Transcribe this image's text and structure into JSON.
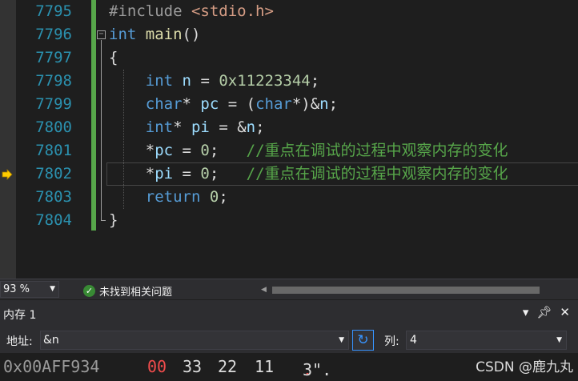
{
  "editor": {
    "lines": [
      {
        "num": "7795",
        "tokens": [
          {
            "t": "#include ",
            "c": "pp"
          },
          {
            "t": "<stdio.h>",
            "c": "inc"
          }
        ]
      },
      {
        "num": "7796",
        "tokens": [
          {
            "t": "int",
            "c": "kw"
          },
          {
            "t": " ",
            "c": "op"
          },
          {
            "t": "main",
            "c": "fn"
          },
          {
            "t": "()",
            "c": "op"
          }
        ]
      },
      {
        "num": "7797",
        "tokens": [
          {
            "t": "{",
            "c": "op"
          }
        ]
      },
      {
        "num": "7798",
        "tokens": [
          {
            "t": "    ",
            "c": "op"
          },
          {
            "t": "int",
            "c": "kw"
          },
          {
            "t": " ",
            "c": "op"
          },
          {
            "t": "n",
            "c": "var"
          },
          {
            "t": " = ",
            "c": "op"
          },
          {
            "t": "0x11223344",
            "c": "num"
          },
          {
            "t": ";",
            "c": "op"
          }
        ]
      },
      {
        "num": "7799",
        "tokens": [
          {
            "t": "    ",
            "c": "op"
          },
          {
            "t": "char",
            "c": "kw"
          },
          {
            "t": "* ",
            "c": "op"
          },
          {
            "t": "pc",
            "c": "var"
          },
          {
            "t": " = (",
            "c": "op"
          },
          {
            "t": "char",
            "c": "kw"
          },
          {
            "t": "*)&",
            "c": "op"
          },
          {
            "t": "n",
            "c": "var"
          },
          {
            "t": ";",
            "c": "op"
          }
        ]
      },
      {
        "num": "7800",
        "tokens": [
          {
            "t": "    ",
            "c": "op"
          },
          {
            "t": "int",
            "c": "kw"
          },
          {
            "t": "* ",
            "c": "op"
          },
          {
            "t": "pi",
            "c": "var"
          },
          {
            "t": " = &",
            "c": "op"
          },
          {
            "t": "n",
            "c": "var"
          },
          {
            "t": ";",
            "c": "op"
          }
        ]
      },
      {
        "num": "7801",
        "tokens": [
          {
            "t": "    *",
            "c": "op"
          },
          {
            "t": "pc",
            "c": "var"
          },
          {
            "t": " = ",
            "c": "op"
          },
          {
            "t": "0",
            "c": "num"
          },
          {
            "t": ";   ",
            "c": "op"
          },
          {
            "t": "//重点在调试的过程中观察内存的变化",
            "c": "cm"
          }
        ]
      },
      {
        "num": "7802",
        "tokens": [
          {
            "t": "    *",
            "c": "op"
          },
          {
            "t": "pi",
            "c": "var"
          },
          {
            "t": " = ",
            "c": "op"
          },
          {
            "t": "0",
            "c": "num"
          },
          {
            "t": ";   ",
            "c": "op"
          },
          {
            "t": "//重点在调试的过程中观察内存的变化",
            "c": "cm"
          }
        ]
      },
      {
        "num": "7803",
        "tokens": [
          {
            "t": "    ",
            "c": "op"
          },
          {
            "t": "return",
            "c": "kw"
          },
          {
            "t": " ",
            "c": "op"
          },
          {
            "t": "0",
            "c": "num"
          },
          {
            "t": ";",
            "c": "op"
          }
        ]
      },
      {
        "num": "7804",
        "tokens": [
          {
            "t": "}",
            "c": "op"
          }
        ]
      }
    ],
    "current_line_index": 7
  },
  "status": {
    "zoom": "93 %",
    "issues_text": "未找到相关问题"
  },
  "memory": {
    "title": "内存 1",
    "address_label": "地址:",
    "address_value": "&n",
    "columns_label": "列:",
    "columns_value": "4",
    "row": {
      "address": "0x00AFF934",
      "bytes": [
        "00",
        "33",
        "22",
        "11"
      ],
      "changed_byte_index": 0,
      "ascii_changed": ".",
      "ascii_rest": "3\"."
    }
  },
  "watermark": "CSDN @鹿九丸",
  "colors": {
    "line_number": "#2b91af",
    "keyword": "#569cd6",
    "comment": "#57a64a",
    "changed_value": "#f14c4c"
  }
}
